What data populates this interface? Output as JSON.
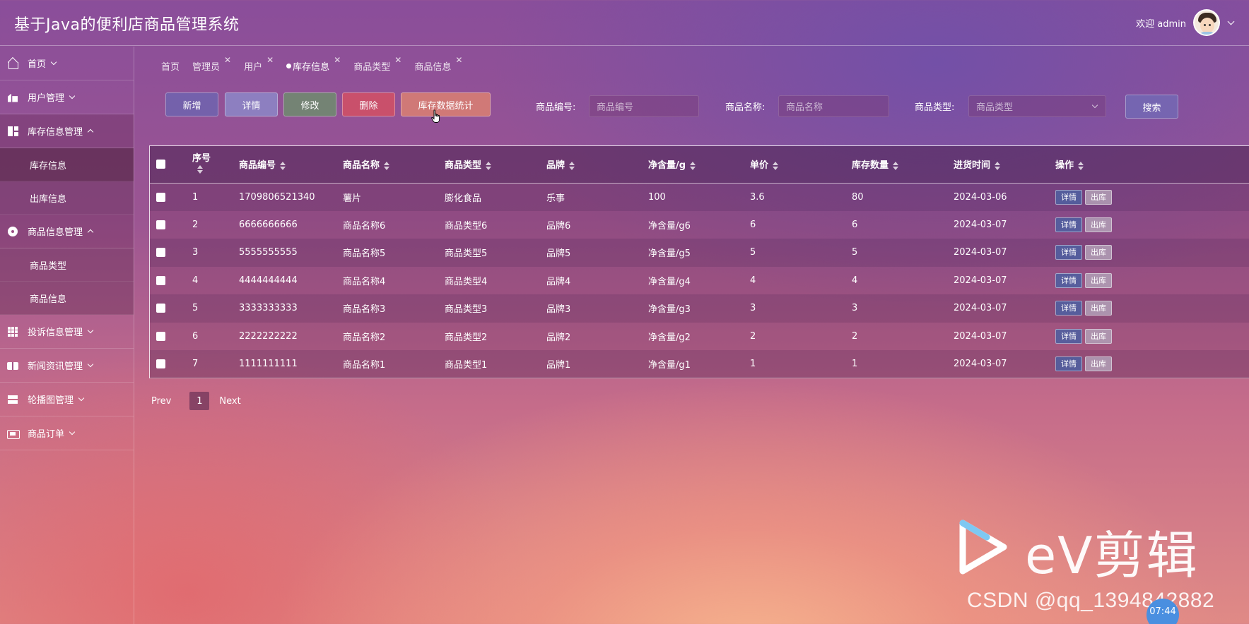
{
  "app": {
    "title": "基于Java的便利店商品管理系统"
  },
  "user": {
    "welcome": "欢迎 admin"
  },
  "sidebar": {
    "items": [
      {
        "label": "首页"
      },
      {
        "label": "用户管理"
      },
      {
        "label": "库存信息管理",
        "children": [
          "库存信息",
          "出库信息"
        ]
      },
      {
        "label": "商品信息管理",
        "children": [
          "商品类型",
          "商品信息"
        ]
      },
      {
        "label": "投诉信息管理"
      },
      {
        "label": "新闻资讯管理"
      },
      {
        "label": "轮播图管理"
      },
      {
        "label": "商品订单"
      }
    ]
  },
  "tabs": [
    {
      "label": "首页",
      "closable": false
    },
    {
      "label": "管理员",
      "closable": true
    },
    {
      "label": "用户",
      "closable": true
    },
    {
      "label": "库存信息",
      "closable": true,
      "active": true
    },
    {
      "label": "商品类型",
      "closable": true
    },
    {
      "label": "商品信息",
      "closable": true
    }
  ],
  "toolbar": {
    "add": "新增",
    "detail": "详情",
    "edit": "修改",
    "delete": "删除",
    "stats": "库存数据统计",
    "search": "搜索",
    "close_glyph": "✕"
  },
  "search": {
    "code_label": "商品编号:",
    "code_placeholder": "商品编号",
    "name_label": "商品名称:",
    "name_placeholder": "商品名称",
    "type_label": "商品类型:",
    "type_placeholder": "商品类型"
  },
  "table": {
    "headers": [
      "序号",
      "商品编号",
      "商品名称",
      "商品类型",
      "品牌",
      "净含量/g",
      "单价",
      "库存数量",
      "进货时间",
      "操作"
    ],
    "row_detail": "详情",
    "row_out": "出库",
    "rows": [
      [
        "1",
        "1709806521340",
        "薯片",
        "膨化食品",
        "乐事",
        "100",
        "3.6",
        "80",
        "2024-03-06"
      ],
      [
        "2",
        "6666666666",
        "商品名称6",
        "商品类型6",
        "品牌6",
        "净含量/g6",
        "6",
        "6",
        "2024-03-07"
      ],
      [
        "3",
        "5555555555",
        "商品名称5",
        "商品类型5",
        "品牌5",
        "净含量/g5",
        "5",
        "5",
        "2024-03-07"
      ],
      [
        "4",
        "4444444444",
        "商品名称4",
        "商品类型4",
        "品牌4",
        "净含量/g4",
        "4",
        "4",
        "2024-03-07"
      ],
      [
        "5",
        "3333333333",
        "商品名称3",
        "商品类型3",
        "品牌3",
        "净含量/g3",
        "3",
        "3",
        "2024-03-07"
      ],
      [
        "6",
        "2222222222",
        "商品名称2",
        "商品类型2",
        "品牌2",
        "净含量/g2",
        "2",
        "2",
        "2024-03-07"
      ],
      [
        "7",
        "1111111111",
        "商品名称1",
        "商品类型1",
        "品牌1",
        "净含量/g1",
        "1",
        "1",
        "2024-03-07"
      ]
    ]
  },
  "pagination": {
    "prev": "Prev",
    "current": "1",
    "next": "Next"
  },
  "watermarks": {
    "ev": "eV剪辑",
    "csdn": "CSDN @qq_1394842882",
    "clock": "07:44"
  }
}
